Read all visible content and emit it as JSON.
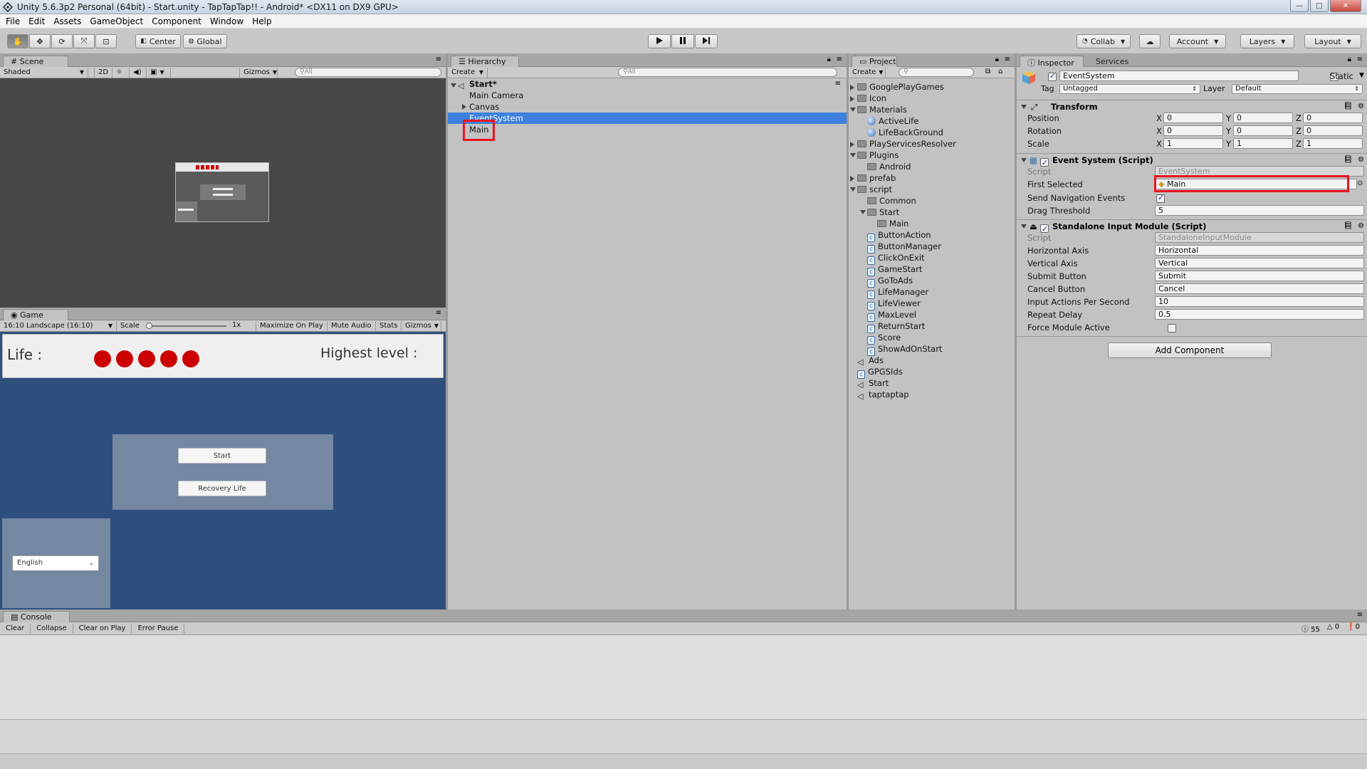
{
  "window": {
    "title": "Unity 5.6.3p2 Personal (64bit) - Start.unity - TapTapTap!! - Android* <DX11 on DX9 GPU>"
  },
  "menu": [
    "File",
    "Edit",
    "Assets",
    "GameObject",
    "Component",
    "Window",
    "Help"
  ],
  "toolbar": {
    "pivot": "Center",
    "space": "Global",
    "collab": "Collab",
    "account": "Account",
    "layers": "Layers",
    "layout": "Layout"
  },
  "scene": {
    "tab": "Scene",
    "shading": "Shaded",
    "mode2d": "2D",
    "gizmos": "Gizmos",
    "search": "All"
  },
  "game": {
    "tab": "Game",
    "aspect": "16:10 Landscape (16:10)",
    "scale_label": "Scale",
    "scale_value": "1x",
    "buttons": [
      "Maximize On Play",
      "Mute Audio",
      "Stats",
      "Gizmos"
    ],
    "life_label": "Life :",
    "life_count": 5,
    "highest_label": "Highest level :",
    "start_button": "Start",
    "recovery_button": "Recovery Life",
    "language": "English"
  },
  "hierarchy": {
    "tab": "Hierarchy",
    "create": "Create",
    "search": "All",
    "root": "Start*",
    "items": [
      "Main Camera",
      "Canvas",
      "EventSystem",
      "Main"
    ],
    "selected": "EventSystem"
  },
  "project": {
    "tab": "Project",
    "create": "Create",
    "items": [
      {
        "label": "GooglePlayGames",
        "type": "folder",
        "depth": 0,
        "state": "collapsed"
      },
      {
        "label": "Icon",
        "type": "folder",
        "depth": 0,
        "state": "collapsed"
      },
      {
        "label": "Materials",
        "type": "folder",
        "depth": 0,
        "state": "expanded"
      },
      {
        "label": "ActiveLife",
        "type": "material",
        "depth": 1,
        "state": "none"
      },
      {
        "label": "LifeBackGround",
        "type": "material",
        "depth": 1,
        "state": "none"
      },
      {
        "label": "PlayServicesResolver",
        "type": "folder",
        "depth": 0,
        "state": "collapsed"
      },
      {
        "label": "Plugins",
        "type": "folder",
        "depth": 0,
        "state": "expanded"
      },
      {
        "label": "Android",
        "type": "folder",
        "depth": 1,
        "state": "none"
      },
      {
        "label": "prefab",
        "type": "folder",
        "depth": 0,
        "state": "collapsed"
      },
      {
        "label": "script",
        "type": "folder",
        "depth": 0,
        "state": "expanded"
      },
      {
        "label": "Common",
        "type": "folder",
        "depth": 1,
        "state": "none"
      },
      {
        "label": "Start",
        "type": "folder",
        "depth": 1,
        "state": "expanded"
      },
      {
        "label": "Main",
        "type": "folder",
        "depth": 2,
        "state": "none"
      },
      {
        "label": "ButtonAction",
        "type": "script",
        "depth": 1,
        "state": "none"
      },
      {
        "label": "ButtonManager",
        "type": "script",
        "depth": 1,
        "state": "none"
      },
      {
        "label": "ClickOnExit",
        "type": "script",
        "depth": 1,
        "state": "none"
      },
      {
        "label": "GameStart",
        "type": "script",
        "depth": 1,
        "state": "none"
      },
      {
        "label": "GoToAds",
        "type": "script",
        "depth": 1,
        "state": "none"
      },
      {
        "label": "LifeManager",
        "type": "script",
        "depth": 1,
        "state": "none"
      },
      {
        "label": "LifeViewer",
        "type": "script",
        "depth": 1,
        "state": "none"
      },
      {
        "label": "MaxLevel",
        "type": "script",
        "depth": 1,
        "state": "none"
      },
      {
        "label": "ReturnStart",
        "type": "script",
        "depth": 1,
        "state": "none"
      },
      {
        "label": "Score",
        "type": "script",
        "depth": 1,
        "state": "none"
      },
      {
        "label": "ShowAdOnStart",
        "type": "script",
        "depth": 1,
        "state": "none"
      },
      {
        "label": "Ads",
        "type": "scene",
        "depth": 0,
        "state": "none"
      },
      {
        "label": "GPGSIds",
        "type": "script",
        "depth": 0,
        "state": "none"
      },
      {
        "label": "Start",
        "type": "scene",
        "depth": 0,
        "state": "none"
      },
      {
        "label": "taptaptap",
        "type": "scene",
        "depth": 0,
        "state": "none"
      }
    ]
  },
  "inspector": {
    "tab": "Inspector",
    "tab2": "Services",
    "object_name": "EventSystem",
    "static_label": "Static",
    "tag_label": "Tag",
    "tag_value": "Untagged",
    "layer_label": "Layer",
    "layer_value": "Default",
    "transform": {
      "title": "Transform",
      "rows": [
        {
          "label": "Position",
          "x": "0",
          "y": "0",
          "z": "0"
        },
        {
          "label": "Rotation",
          "x": "0",
          "y": "0",
          "z": "0"
        },
        {
          "label": "Scale",
          "x": "1",
          "y": "1",
          "z": "1"
        }
      ]
    },
    "event_system": {
      "title": "Event System (Script)",
      "script_label": "Script",
      "script_value": "EventSystem",
      "first_selected_label": "First Selected",
      "first_selected_value": "Main",
      "send_nav_label": "Send Navigation Events",
      "send_nav_checked": true,
      "drag_label": "Drag Threshold",
      "drag_value": "5"
    },
    "input_module": {
      "title": "Standalone Input Module (Script)",
      "rows": [
        {
          "label": "Script",
          "value": "StandaloneInputModule"
        },
        {
          "label": "Horizontal Axis",
          "value": "Horizontal"
        },
        {
          "label": "Vertical Axis",
          "value": "Vertical"
        },
        {
          "label": "Submit Button",
          "value": "Submit"
        },
        {
          "label": "Cancel Button",
          "value": "Cancel"
        },
        {
          "label": "Input Actions Per Second",
          "value": "10"
        },
        {
          "label": "Repeat Delay",
          "value": "0.5"
        }
      ],
      "force_label": "Force Module Active",
      "force_checked": false
    },
    "add_component": "Add Component"
  },
  "console": {
    "tab": "Console",
    "buttons": [
      "Clear",
      "Collapse",
      "Clear on Play",
      "Error Pause"
    ],
    "info_count": "55",
    "warn_count": "0",
    "error_count": "0"
  },
  "colors": {
    "selection": "#3d80df",
    "highlight_box": "#e8141e",
    "game_bg": "#2f4f7f",
    "life_dot": "#cc0000"
  }
}
